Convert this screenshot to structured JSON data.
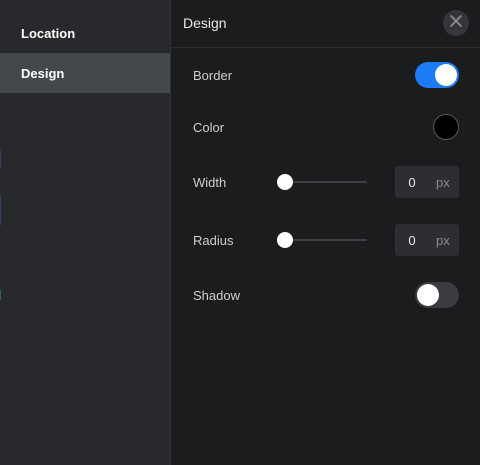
{
  "sidebar": {
    "items": [
      {
        "label": "Location",
        "active": false
      },
      {
        "label": "Design",
        "active": true
      }
    ]
  },
  "panel": {
    "title": "Design",
    "close_icon": "close-icon"
  },
  "fields": {
    "border": {
      "label": "Border",
      "enabled": true
    },
    "color": {
      "label": "Color",
      "value": "#000000"
    },
    "width": {
      "label": "Width",
      "value": "0",
      "unit": "px",
      "slider_level": 0
    },
    "radius": {
      "label": "Radius",
      "value": "0",
      "unit": "px",
      "slider_level": 0
    },
    "shadow": {
      "label": "Shadow",
      "enabled": false
    }
  },
  "colors": {
    "accent": "#1c7cf4",
    "toggle_off": "#3a3c40",
    "sidebar_bg": "#27292c",
    "sidebar_active": "#44474c",
    "panel_bg": "#1b1c1e"
  }
}
